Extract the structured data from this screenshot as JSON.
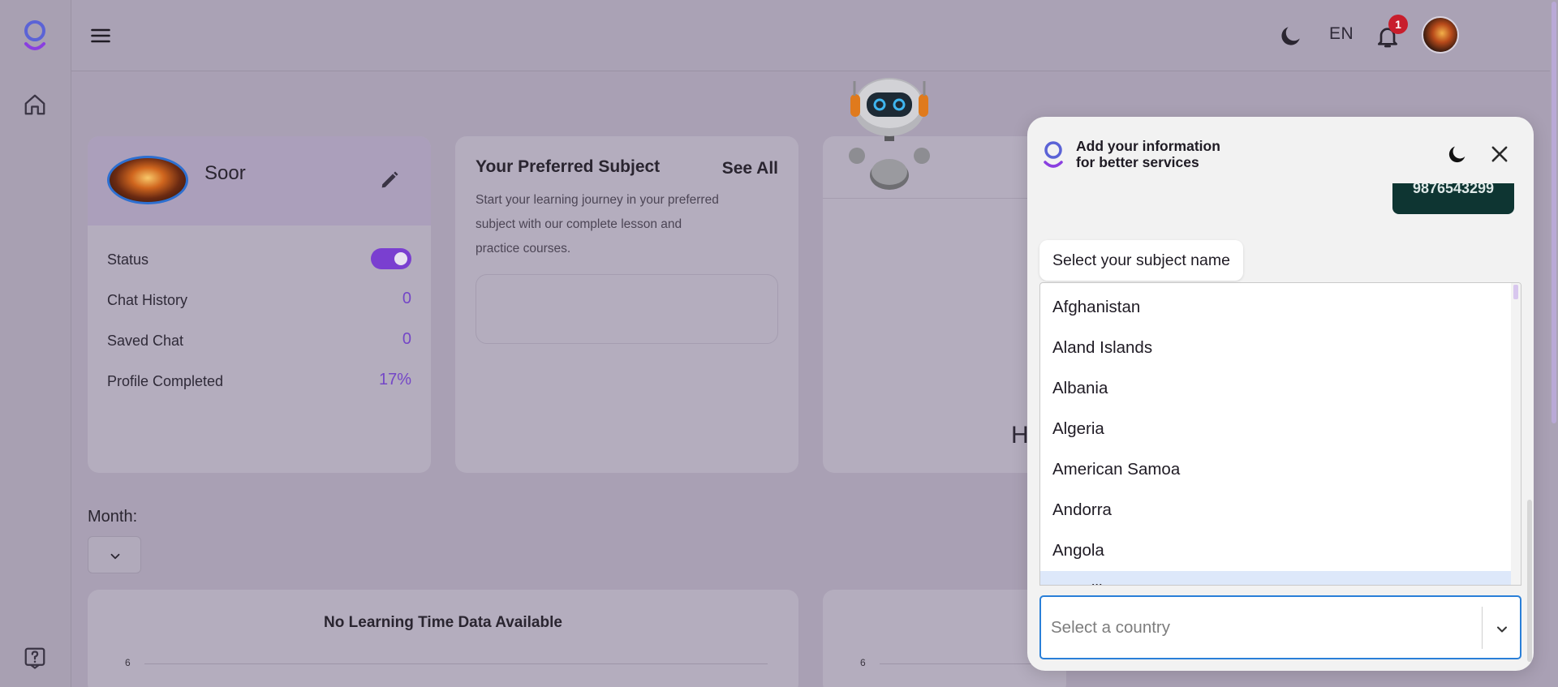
{
  "header": {
    "language": "EN",
    "notification_count": "1"
  },
  "profile": {
    "name": "Soor",
    "rows": [
      {
        "label": "Status",
        "value": ""
      },
      {
        "label": "Chat History",
        "value": "0"
      },
      {
        "label": "Saved Chat",
        "value": "0"
      },
      {
        "label": "Profile Completed",
        "value": "17%"
      }
    ],
    "status_on": true
  },
  "preferred_subject": {
    "title": "Your Preferred Subject",
    "see_all": "See All",
    "description": "Start your learning journey in your preferred subject with our complete lesson and practice courses."
  },
  "third_card": {
    "partial_text": "H"
  },
  "month": {
    "label": "Month:",
    "value": ""
  },
  "charts": [
    {
      "title": "No Learning Time Data Available",
      "tick": "6"
    },
    {
      "title": "",
      "tick": "6"
    }
  ],
  "modal": {
    "title_line1": "Add your information",
    "title_line2": "for better services",
    "phone_bubble": "9876543299",
    "prompt": "Select your subject name",
    "options": [
      "Afghanistan",
      "Aland Islands",
      "Albania",
      "Algeria",
      "American Samoa",
      "Andorra",
      "Angola",
      "Anguilla"
    ],
    "highlighted_index": 7,
    "country_placeholder": "Select a country"
  },
  "colors": {
    "accent": "#7446c7",
    "toggle": "#7a3fd0",
    "badge": "#c81e2c",
    "phone_bubble": "#0e3532",
    "select_border": "#2a7fd8"
  }
}
